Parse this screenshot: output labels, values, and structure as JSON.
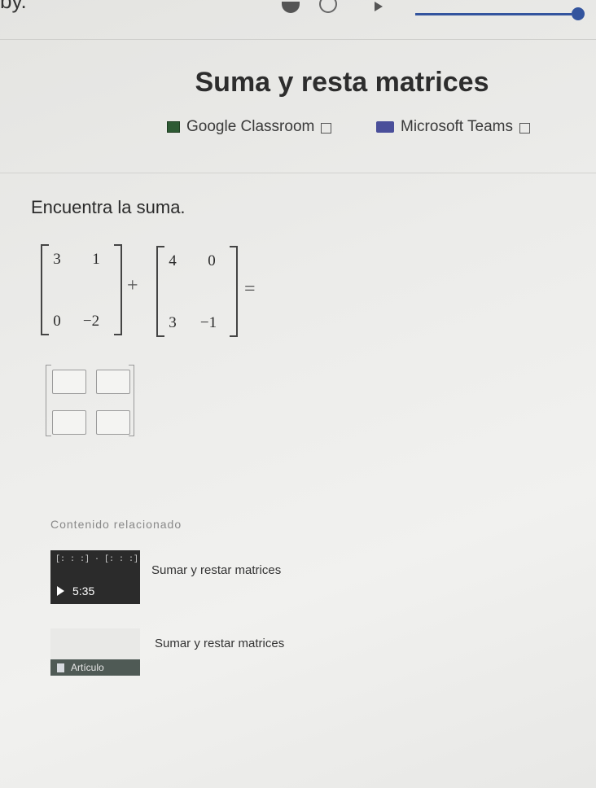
{
  "top_fragment": "by.",
  "progress": {
    "fraction": 0.96,
    "color": "#33549e"
  },
  "title": "Suma y resta matrices",
  "share": {
    "classroom_label": "Google Classroom",
    "teams_label": "Microsoft Teams"
  },
  "prompt": "Encuentra la suma.",
  "matrix_a": {
    "r1": [
      "3",
      "1"
    ],
    "r2": [
      "0",
      "−2"
    ]
  },
  "op_plus": "+",
  "matrix_b": {
    "r1": [
      "4",
      "0"
    ],
    "r2": [
      "3",
      "−1"
    ]
  },
  "op_equals": "=",
  "answer": {
    "cells": [
      "",
      "",
      "",
      ""
    ]
  },
  "related": {
    "heading": "Contenido relacionado",
    "video": {
      "thumb_text": "[: : :] · [: : :]",
      "duration": "5:35",
      "title": "Sumar y restar matrices"
    },
    "article": {
      "badge": "Artículo",
      "title": "Sumar y restar matrices"
    }
  }
}
